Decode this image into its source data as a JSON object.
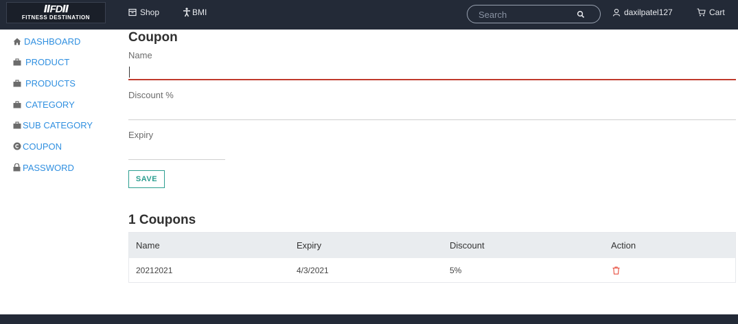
{
  "header": {
    "logo_mark": "ⅡFDⅡ",
    "logo_text": "FITNESS DESTINATION",
    "nav": {
      "shop": "Shop",
      "bmi": "BMI"
    },
    "search_placeholder": "Search",
    "user": "daxilpatel127",
    "cart": "Cart"
  },
  "sidebar": {
    "items": [
      {
        "label": "DASHBOARD",
        "icon": "home-icon"
      },
      {
        "label": "PRODUCT",
        "icon": "bag-icon"
      },
      {
        "label": "PRODUCTS",
        "icon": "bag-icon"
      },
      {
        "label": "CATEGORY",
        "icon": "bag-icon"
      },
      {
        "label": "SUB CATEGORY",
        "icon": "bag-icon"
      },
      {
        "label": "COUPON",
        "icon": "copyright-icon"
      },
      {
        "label": "PASSWORD",
        "icon": "lock-icon"
      }
    ]
  },
  "form": {
    "title": "Coupon",
    "name_label": "Name",
    "name_value": "",
    "discount_label": "Discount %",
    "discount_value": "",
    "expiry_label": "Expiry",
    "expiry_value": "",
    "save_label": "SAVE"
  },
  "list": {
    "title": "1 Coupons",
    "columns": [
      "Name",
      "Expiry",
      "Discount",
      "Action"
    ],
    "rows": [
      {
        "name": "20212021",
        "expiry": "4/3/2021",
        "discount": "5%",
        "action_icon": "trash-icon"
      }
    ]
  },
  "colors": {
    "header_bg": "#232a37",
    "link": "#2f8fe0",
    "accent_red": "#c0392b",
    "save_teal": "#2a9d8f"
  }
}
